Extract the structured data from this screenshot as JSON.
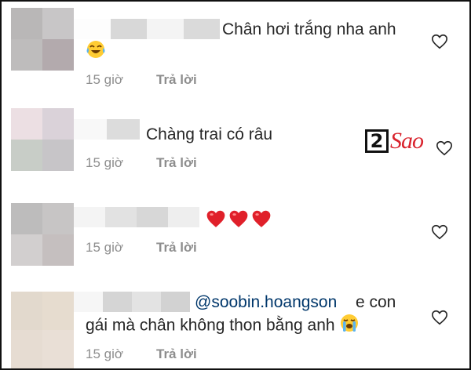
{
  "comments": [
    {
      "text": "Chân hơi trắng nha anh",
      "time": "15 giờ",
      "reply": "Trả lời"
    },
    {
      "text": "Chàng trai có râu",
      "time": "15 giờ",
      "reply": "Trả lời"
    },
    {
      "text": "",
      "time": "15 giờ",
      "reply": "Trả lời"
    },
    {
      "mention": "@soobin.hoangson",
      "text_line1": "e con",
      "text_line2": "gái mà chân không thon bằng anh",
      "time": "15 giờ",
      "reply": "Trả lời"
    }
  ],
  "logo": {
    "number": "2",
    "text": "Sao"
  },
  "icons": {
    "like": "heart-outline-icon",
    "laugh_cry": "face-with-tears-of-joy-icon",
    "sob": "loudly-crying-face-icon",
    "heart": "red-heart-icon"
  },
  "colors": {
    "text": "#262626",
    "meta": "#8e8e8e",
    "mention": "#00376b",
    "heart_red": "#e0202a",
    "logo_red": "#d9232d"
  }
}
